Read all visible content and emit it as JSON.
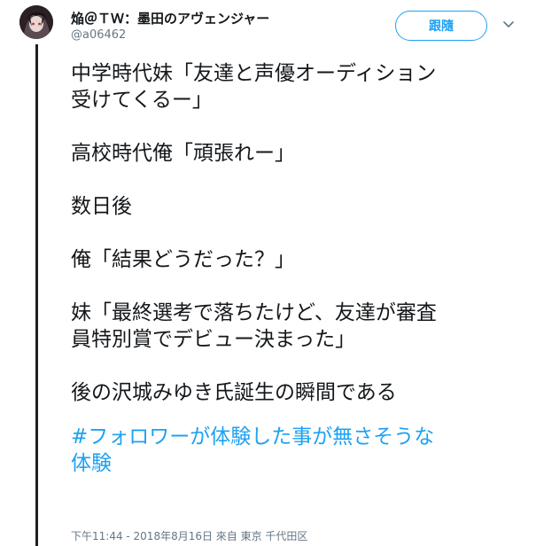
{
  "tweet": {
    "display_name": "焔＠ＴＷ：墨田のアヴェンジャー",
    "handle": "@a06462",
    "follow_label": "跟隨",
    "paragraphs": [
      "中学時代妹「友達と声優オーディション\n受けてくるー」",
      "高校時代俺「頑張れー」",
      "数日後",
      "俺「結果どうだった？」",
      "妹「最終選考で落ちたけど、友達が審査\n員特別賞でデビュー決まった」",
      "後の沢城みゆき氏誕生の瞬間である"
    ],
    "hashtag": "#フォロワーが体験した事が無さそうな\n体験",
    "timestamp": "下午11:44 - 2018年8月16日 來自 東京 千代田区"
  },
  "colors": {
    "accent": "#1da1f2",
    "secondary_text": "#657786",
    "primary_text": "#14171a",
    "thread_line": "#1f1f1f"
  },
  "icons": {
    "avatar": "user-avatar-image",
    "caret": "chevron-down-icon"
  }
}
